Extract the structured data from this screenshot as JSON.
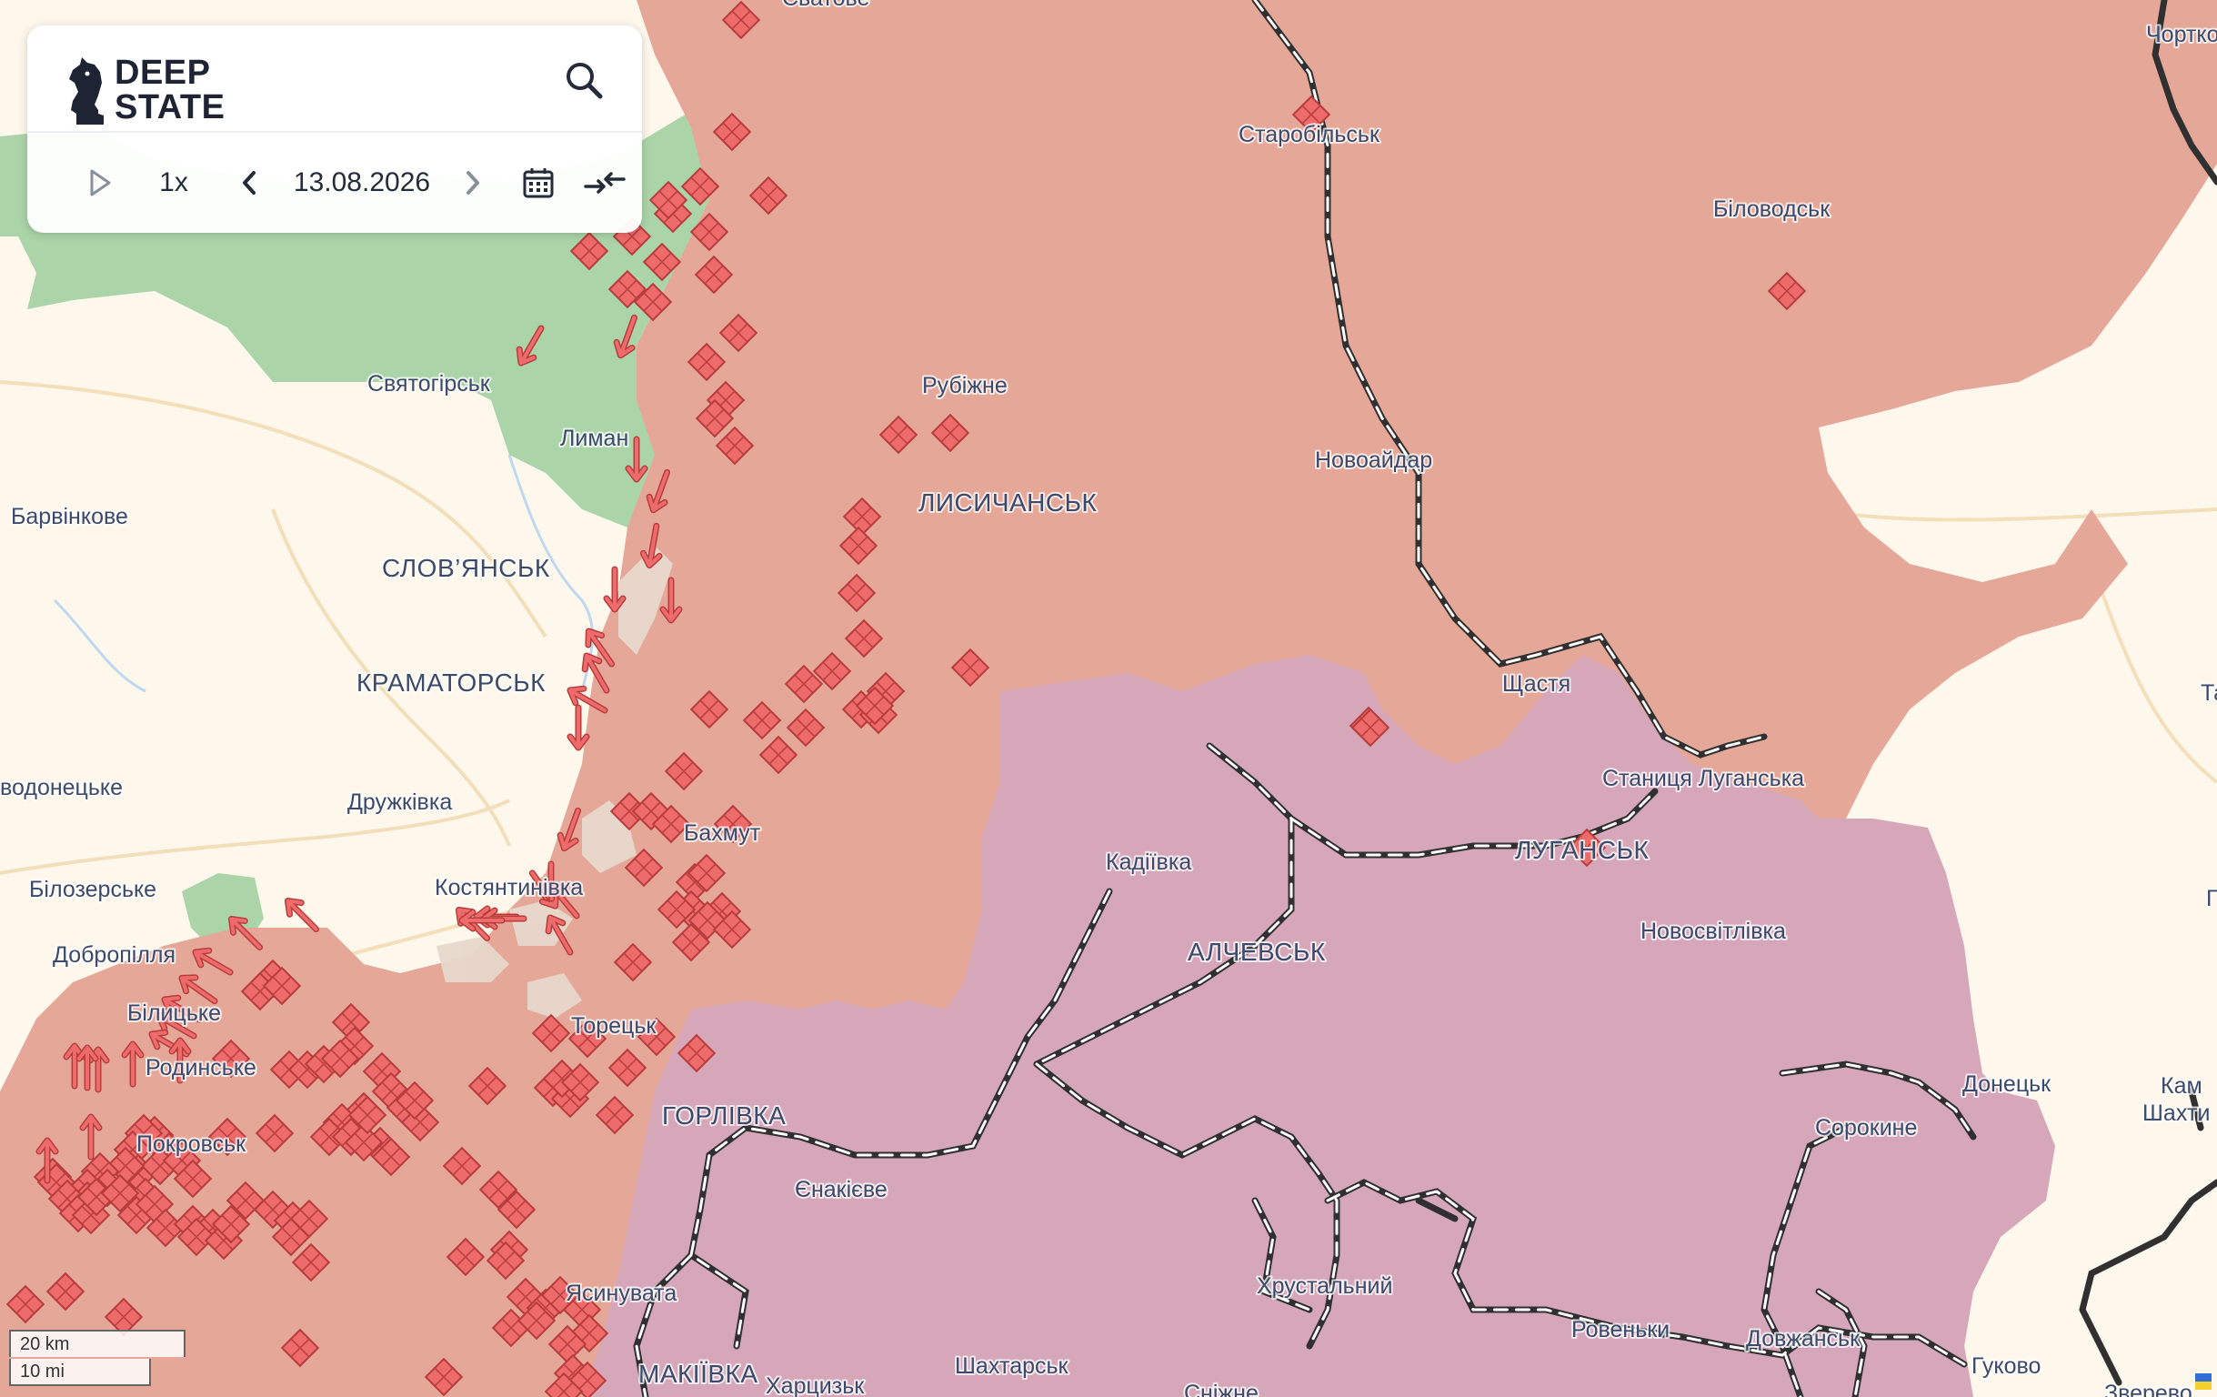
{
  "app": {
    "logo_line1": "DEEP",
    "logo_line2": "STATE",
    "search_icon": "search-icon"
  },
  "timeline": {
    "speed": "1x",
    "date": "13.08.2026",
    "play_icon": "play-icon",
    "prev_icon": "chevron-left-icon",
    "next_icon": "chevron-right-icon",
    "calendar_icon": "calendar-icon",
    "compare_icon": "compare-arrows-icon"
  },
  "scale": {
    "km": "20 km",
    "mi": "10 mi"
  },
  "colors": {
    "free_land": "#fdf7ec",
    "liberated": "#a7d3a4",
    "occupied": "#e5a898",
    "occupied_pre2022": "#d6a7b8",
    "contested": "#e8dcd2",
    "marker": "#ee6b6b",
    "label": "#3c4a6b"
  },
  "places": [
    {
      "id": "svatove",
      "name": "Сватове",
      "size": "normal"
    },
    {
      "id": "chortkove",
      "name": "Чорткове",
      "size": "normal"
    },
    {
      "id": "starobilsk",
      "name": "Старобільськ",
      "size": "normal"
    },
    {
      "id": "bilovodsk",
      "name": "Біловодськ",
      "size": "normal"
    },
    {
      "id": "svyatohirsk",
      "name": "Святогірськ",
      "size": "normal"
    },
    {
      "id": "rubizhne",
      "name": "Рубіжне",
      "size": "normal"
    },
    {
      "id": "lyman",
      "name": "Лиман",
      "size": "normal"
    },
    {
      "id": "novoaidar",
      "name": "Новоайдар",
      "size": "normal"
    },
    {
      "id": "lysychansk",
      "name": "ЛИСИЧАНСЬК",
      "size": "big"
    },
    {
      "id": "barvinkove",
      "name": "Барвінкове",
      "size": "normal"
    },
    {
      "id": "slovyansk",
      "name": "СЛОВ’ЯНСЬК",
      "size": "big"
    },
    {
      "id": "kramatorsk",
      "name": "КРАМАТОРСЬК",
      "size": "big"
    },
    {
      "id": "shchastia",
      "name": "Щастя",
      "size": "normal"
    },
    {
      "id": "stanytsia",
      "name": "Станиця Луганська",
      "size": "normal"
    },
    {
      "id": "vodonetske",
      "name": "водонецьке",
      "size": "normal"
    },
    {
      "id": "druzhkivka",
      "name": "Дружківка",
      "size": "normal"
    },
    {
      "id": "bakhmut",
      "name": "Бахмут",
      "size": "normal"
    },
    {
      "id": "kadiivka",
      "name": "Кадіївка",
      "size": "normal"
    },
    {
      "id": "luhansk",
      "name": "ЛУГАНСЬК",
      "size": "big"
    },
    {
      "id": "bilozerske",
      "name": "Білозерське",
      "size": "normal"
    },
    {
      "id": "kostiantynivka",
      "name": "Костянтинівка",
      "size": "normal"
    },
    {
      "id": "dobropillia",
      "name": "Добропілля",
      "size": "normal"
    },
    {
      "id": "alchevsk",
      "name": "АЛЧЕВСЬК",
      "size": "big"
    },
    {
      "id": "novosvitlivka",
      "name": "Новосвітлівка",
      "size": "normal"
    },
    {
      "id": "bilytske",
      "name": "Білицьке",
      "size": "normal"
    },
    {
      "id": "toretsk",
      "name": "Торецьк",
      "size": "normal"
    },
    {
      "id": "rodynske",
      "name": "Родинське",
      "size": "normal"
    },
    {
      "id": "horlivka",
      "name": "ГОРЛІВКА",
      "size": "big"
    },
    {
      "id": "donetsk_town",
      "name": "Донецьк",
      "size": "normal"
    },
    {
      "id": "kam",
      "name": "Кам",
      "size": "normal"
    },
    {
      "id": "shakhty",
      "name": "Шахти",
      "size": "normal"
    },
    {
      "id": "sorokyne",
      "name": "Сорокине",
      "size": "normal"
    },
    {
      "id": "pokrovsk",
      "name": "Покровськ",
      "size": "normal"
    },
    {
      "id": "yenakiieve",
      "name": "Єнакієве",
      "size": "normal"
    },
    {
      "id": "khrustalnyi",
      "name": "Хрустальний",
      "size": "normal"
    },
    {
      "id": "yasynuvata",
      "name": "Ясинувата",
      "size": "normal"
    },
    {
      "id": "rovenky",
      "name": "Ровеньки",
      "size": "normal"
    },
    {
      "id": "dovzhansk",
      "name": "Довжанськ",
      "size": "normal"
    },
    {
      "id": "makiivka",
      "name": "МАКІЇВКА",
      "size": "big"
    },
    {
      "id": "shakhtarsk",
      "name": "Шахтарськ",
      "size": "normal"
    },
    {
      "id": "khartsyzk",
      "name": "Харцизьк",
      "size": "normal"
    },
    {
      "id": "snizhne",
      "name": "Сніжне",
      "size": "normal"
    },
    {
      "id": "hukovo",
      "name": "Гуково",
      "size": "normal"
    },
    {
      "id": "zverevo",
      "name": "Зверево",
      "size": "normal"
    },
    {
      "id": "ta",
      "name": "Та",
      "size": "normal"
    },
    {
      "id": "g",
      "name": "Г",
      "size": "normal"
    }
  ]
}
